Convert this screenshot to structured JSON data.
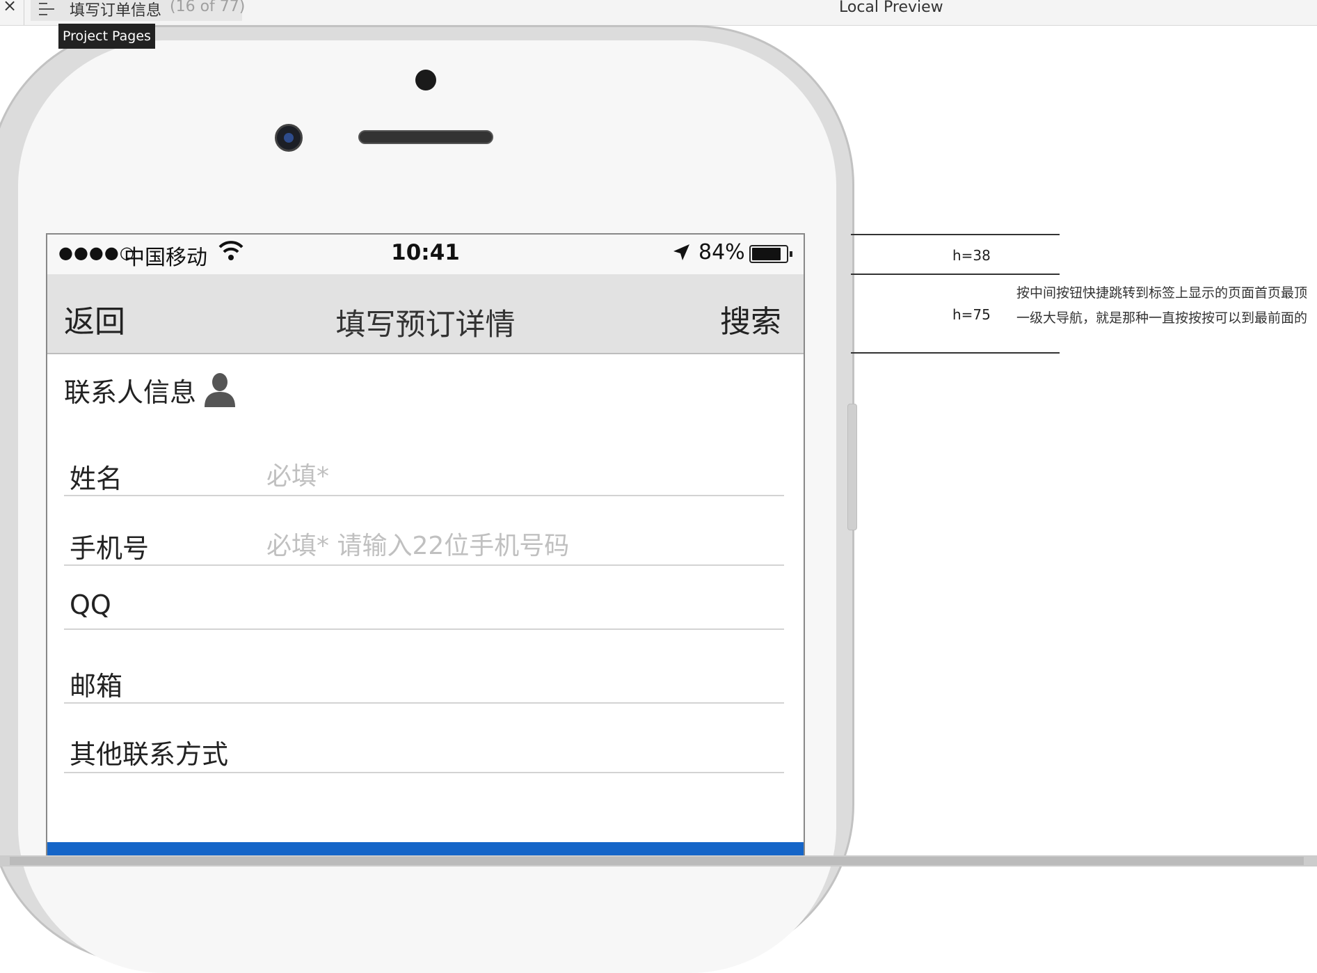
{
  "preview": {
    "tab_title": "填写订单信息",
    "tab_count": "(16 of 77)",
    "window_title": "Local Preview",
    "tooltip": "Project Pages"
  },
  "status_bar": {
    "signal": "●●●●○",
    "carrier": "中国移动",
    "time": "10:41",
    "battery": "84%"
  },
  "nav": {
    "back": "返回",
    "title": "填写预订详情",
    "search": "搜索"
  },
  "form": {
    "section_title": "联系人信息",
    "fields": [
      {
        "label": "姓名",
        "placeholder": "必填*"
      },
      {
        "label": "手机号",
        "placeholder": "必填* 请输入22位手机号码"
      },
      {
        "label": "QQ",
        "placeholder": ""
      },
      {
        "label": "邮箱",
        "placeholder": ""
      },
      {
        "label": "其他联系方式",
        "placeholder": ""
      }
    ]
  },
  "annotations": {
    "status_height": "h=38",
    "nav_height": "h=75",
    "note_line1": "按中间按钮快捷跳转到标签上显示的页面首页最顶",
    "note_line2": "一级大导航，就是那种一直按按按可以到最前面的"
  },
  "colors": {
    "submit_bar": "#1565c8",
    "nav_bg": "#e2e2e2",
    "placeholder": "#c0c0c0"
  },
  "icons": [
    "close-icon",
    "hamburger-icon",
    "wifi-icon",
    "location-arrow-icon",
    "battery-icon",
    "person-icon"
  ]
}
